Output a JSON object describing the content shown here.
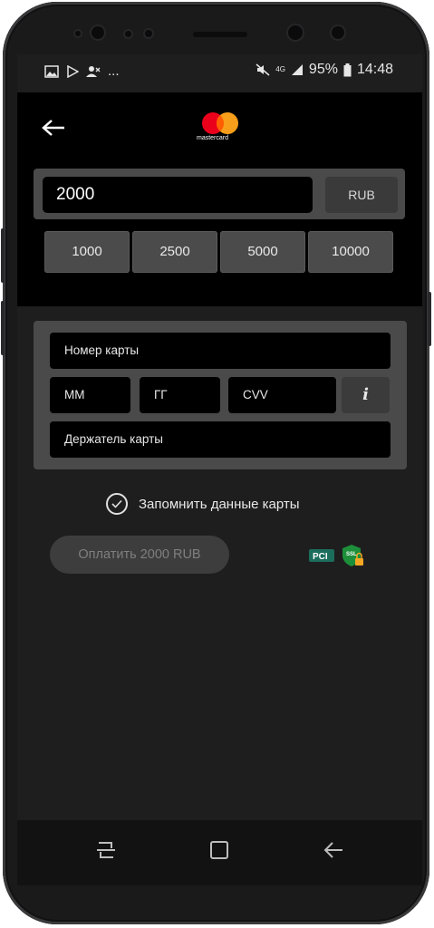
{
  "status_bar": {
    "left_icons": [
      "image-icon",
      "play-store-icon",
      "missed-call-icon"
    ],
    "more": "...",
    "network": "4G",
    "battery": "95%",
    "time": "14:48"
  },
  "header": {
    "back_icon": "arrow-left-icon",
    "brand": "mastercard"
  },
  "amount": {
    "value": "2000",
    "currency": "RUB",
    "presets": [
      "1000",
      "2500",
      "5000",
      "10000"
    ]
  },
  "card_form": {
    "card_number_placeholder": "Номер карты",
    "month_placeholder": "ММ",
    "year_placeholder": "ГГ",
    "cvv_placeholder": "CVV",
    "info_icon": "i",
    "holder_placeholder": "Держатель карты"
  },
  "remember": {
    "label": "Запомнить данные карты",
    "checked": true
  },
  "pay_button": {
    "label": "Оплатить 2000 RUB"
  },
  "badges": {
    "pci": "PCI",
    "ssl": "SSL"
  },
  "navigation": {
    "recent_icon": "recent-apps-icon",
    "home_icon": "home-icon",
    "back_icon": "back-icon"
  },
  "colors": {
    "background": "#1e1e1f",
    "header": "#000000",
    "panel": "#4a4a4b",
    "pay_button": "#3d3d3e"
  }
}
